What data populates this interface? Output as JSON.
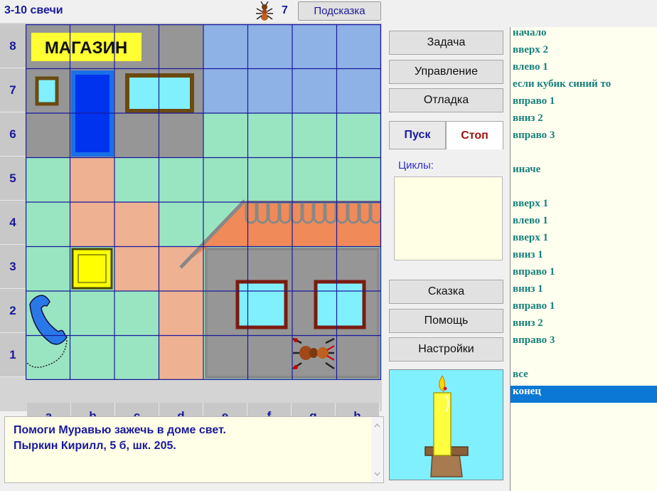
{
  "header": {
    "title": "3-10 свечи",
    "ant_count": "7",
    "hint_label": "Подсказка"
  },
  "board": {
    "row_labels": [
      "8",
      "7",
      "6",
      "5",
      "4",
      "3",
      "2",
      "1"
    ],
    "col_labels": [
      "a",
      "b",
      "c",
      "d",
      "e",
      "f",
      "g",
      "h"
    ],
    "shop_sign": "МАГАЗИН"
  },
  "buttons": {
    "task": "Задача",
    "control": "Управление",
    "debug": "Отладка",
    "run": "Пуск",
    "stop": "Стоп",
    "tale": "Сказка",
    "help": "Помощь",
    "settings": "Настройки"
  },
  "cycles": {
    "label": "Циклы:"
  },
  "program": {
    "lines": [
      "начало",
      "вверх 2",
      "влево 1",
      "если кубик синий то",
      "вправо 1",
      "вниз 2",
      "вправо 3",
      "",
      "иначе",
      "",
      "вверх 1",
      "влево 1",
      "вверх 1",
      "вниз 1",
      "вправо 1",
      "вниз 1",
      "вправо 1",
      "вниз 2",
      "вправо 3",
      "",
      "все",
      "конец"
    ],
    "selected_index": 21
  },
  "message": {
    "line1": "Помоги Муравью зажечь в доме свет.",
    "line2": "Пыркин Кирилл, 5 б, шк. 205."
  },
  "colors": {
    "grid_line": "#1a1a9c",
    "mint": "#99e5c2",
    "peach": "#eeb292",
    "shop_gray": "#969696",
    "sky_blue": "#8fb2e6",
    "roof_orange": "#f08a58",
    "yellow_cube": "#ffff00",
    "blue_door": "#0033ee",
    "selection": "#0a78d4"
  }
}
